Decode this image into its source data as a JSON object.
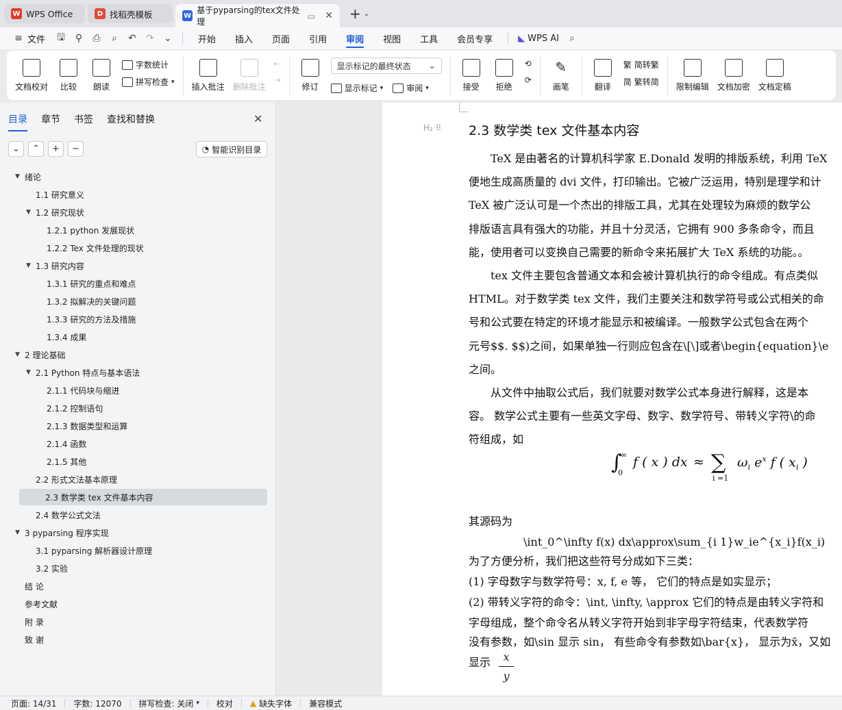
{
  "tabs": [
    {
      "label": "WPS Office",
      "icon": "wps-icon"
    },
    {
      "label": "找稻壳模板",
      "icon": "docer-icon"
    },
    {
      "label": "基于pyparsing的tex文件处理",
      "icon": "word-doc-icon"
    }
  ],
  "menu": {
    "file": "文件",
    "items": [
      "开始",
      "插入",
      "页面",
      "引用",
      "审阅",
      "视图",
      "工具",
      "会员专享"
    ],
    "active": "审阅",
    "ai": "WPS AI"
  },
  "ribbon": {
    "doc_check": "文档校对",
    "compare": "比较",
    "read": "朗读",
    "word_count": "字数统计",
    "spell_check": "拼写检查",
    "insert_comment": "插入批注",
    "delete_comment": "删除批注",
    "track": "修订",
    "markup_select": "显示标记的最终状态",
    "show_markup": "显示标记",
    "review": "审阅",
    "accept": "接受",
    "reject": "拒绝",
    "pen": "画笔",
    "translate": "翻译",
    "to_traditional": "简转繁",
    "to_simplified": "繁转简",
    "restrict_edit": "限制编辑",
    "encrypt": "文档加密",
    "finalize": "文档定稿"
  },
  "nav": {
    "tabs": [
      "目录",
      "章节",
      "书签",
      "查找和替换"
    ],
    "smart_toc": "智能识别目录",
    "toc": [
      {
        "label": "绪论",
        "level": 0,
        "arrow": "▼"
      },
      {
        "label": "1.1  研究意义",
        "level": 1,
        "arrow": ""
      },
      {
        "label": "1.2  研究现状",
        "level": 1,
        "arrow": "▼"
      },
      {
        "label": "1.2.1 python 发展现状",
        "level": 2,
        "arrow": ""
      },
      {
        "label": "1.2.2 Tex 文件处理的现状",
        "level": 2,
        "arrow": ""
      },
      {
        "label": "1.3  研究内容",
        "level": 1,
        "arrow": "▼"
      },
      {
        "label": "1.3.1  研究的重点和难点",
        "level": 2,
        "arrow": ""
      },
      {
        "label": "1.3.2  拟解决的关键问题",
        "level": 2,
        "arrow": ""
      },
      {
        "label": "1.3.3  研究的方法及措施",
        "level": 2,
        "arrow": ""
      },
      {
        "label": "1.3.4 成果",
        "level": 2,
        "arrow": ""
      },
      {
        "label": "2  理论基础",
        "level": 0,
        "arrow": "▼"
      },
      {
        "label": "2.1 Python 特点与基本语法",
        "level": 1,
        "arrow": "▼"
      },
      {
        "label": "2.1.1 代码块与缩进",
        "level": 2,
        "arrow": ""
      },
      {
        "label": "2.1.2 控制语句",
        "level": 2,
        "arrow": ""
      },
      {
        "label": "2.1.3 数据类型和运算",
        "level": 2,
        "arrow": ""
      },
      {
        "label": "2.1.4 函数",
        "level": 2,
        "arrow": ""
      },
      {
        "label": "2.1.5 其他",
        "level": 2,
        "arrow": ""
      },
      {
        "label": "2.2 形式文法基本原理",
        "level": 1,
        "arrow": ""
      },
      {
        "label": "2.3 数学类 tex 文件基本内容",
        "level": 1,
        "arrow": "",
        "selected": true
      },
      {
        "label": "2.4  数学公式文法",
        "level": 1,
        "arrow": ""
      },
      {
        "label": "3  pyparsing  程序实现",
        "level": 0,
        "arrow": "▼"
      },
      {
        "label": "3.1 pyparsing 解析器设计原理",
        "level": 1,
        "arrow": ""
      },
      {
        "label": "3.2  实验",
        "level": 1,
        "arrow": ""
      },
      {
        "label": "结  论",
        "level": 0,
        "arrow": ""
      },
      {
        "label": "参考文献",
        "level": 0,
        "arrow": ""
      },
      {
        "label": "附  录",
        "level": 0,
        "arrow": ""
      },
      {
        "label": "致  谢",
        "level": 0,
        "arrow": ""
      }
    ]
  },
  "doc": {
    "heading": "2.3 数学类 tex 文件基本内容",
    "lines": [
      "　　TeX 是由著名的计算机科学家 E.Donald 发明的排版系统，利用 TeX",
      "便地生成高质量的 dvi 文件，打印输出。它被广泛运用，特别是理学和计",
      "TeX 被广泛认可是一个杰出的排版工具，尤其在处理较为麻烦的数学公",
      "排版语言具有强大的功能，并且十分灵活，它拥有 900 多条命令，而且",
      "能，使用者可以变换自己需要的新命令来拓展扩大 TeX 系统的功能。。",
      "　　tex 文件主要包含普通文本和会被计算机执行的命令组成。有点类似",
      "HTML。对于数学类 tex 文件，我们主要关注和数学符号或公式相关的命",
      "号和公式要在特定的环境才能显示和被编译。一般数学公式包含在两个",
      "元号$$. $$)之间，如果单独一行则应包含在\\[\\]或者\\begin{equation}\\e",
      "之间。",
      "　　从文件中抽取公式后，我们就要对数学公式本身进行解释，这是本",
      "容。 数学公式主要有一些英文字母、数字、数学符号、带转义字符\\的命",
      "符组成，如"
    ],
    "lines2": [
      "其源码为",
      "　　　　　\\int_0^\\infty  f(x) dx\\approx\\sum_{i  1}w_ie^{x_i}f(x_i)",
      "为了方便分析，我们把这些符号分成如下三类：",
      "(1)  字母数字与数学符号：x, f, e 等，  它们的特点是如实显示；",
      "(2)  带转义字符的命令：\\int, \\infty, \\approx 它们的特点是由转义字符和",
      "字母组成，整个命令名从转义字符开始到非字母字符结束，代表数学符",
      "没有参数，如\\sin 显示 sin，  有些命令有参数如\\bar{x}，  显示为x̄，又如",
      "显示"
    ]
  },
  "status": {
    "page": "页面: 14/31",
    "words": "字数: 12070",
    "spell": "拼写检查: 关闭",
    "proof": "校对",
    "missing_font": "缺失字体",
    "compat": "兼容模式"
  }
}
